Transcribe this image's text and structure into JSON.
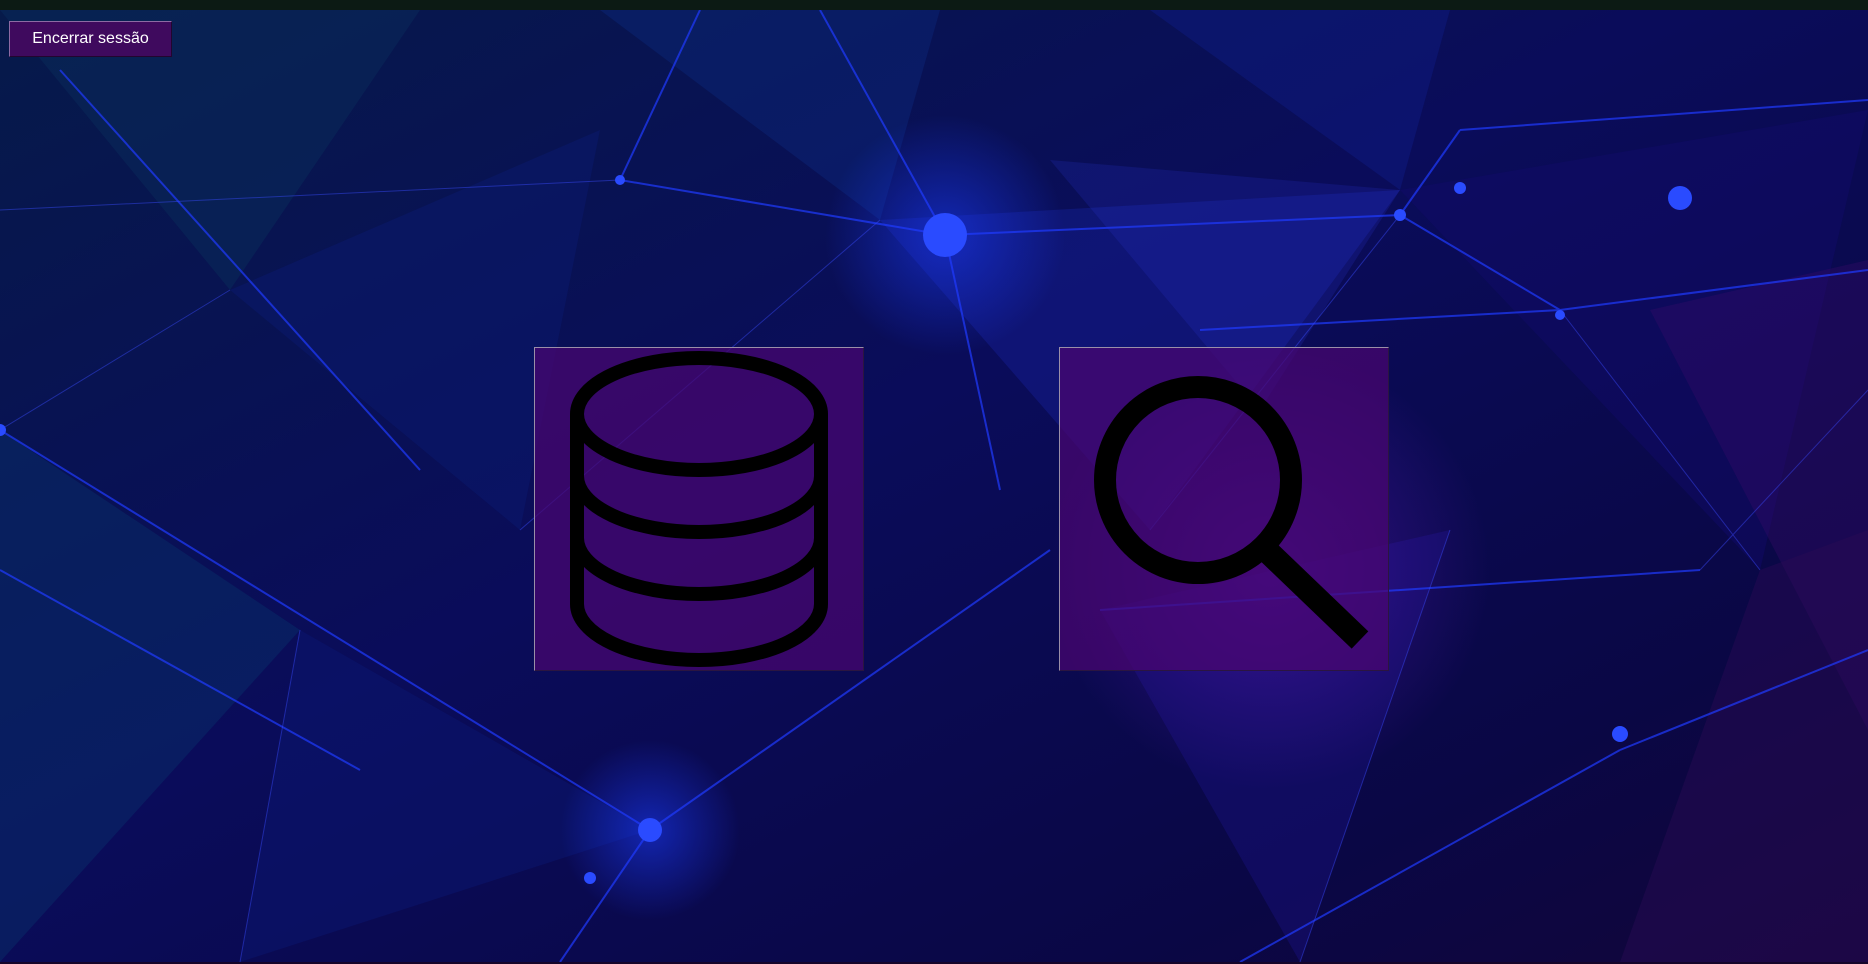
{
  "header": {
    "logout_label": "Encerrar sessão"
  },
  "tiles": [
    {
      "icon": "database-icon"
    },
    {
      "icon": "search-icon"
    }
  ],
  "colors": {
    "button_bg": "#3f0a5e",
    "tile_bg": "#4a0670",
    "icon_stroke": "#000000",
    "background_base": "#0a0826",
    "network_lines": "#1f2cff"
  }
}
